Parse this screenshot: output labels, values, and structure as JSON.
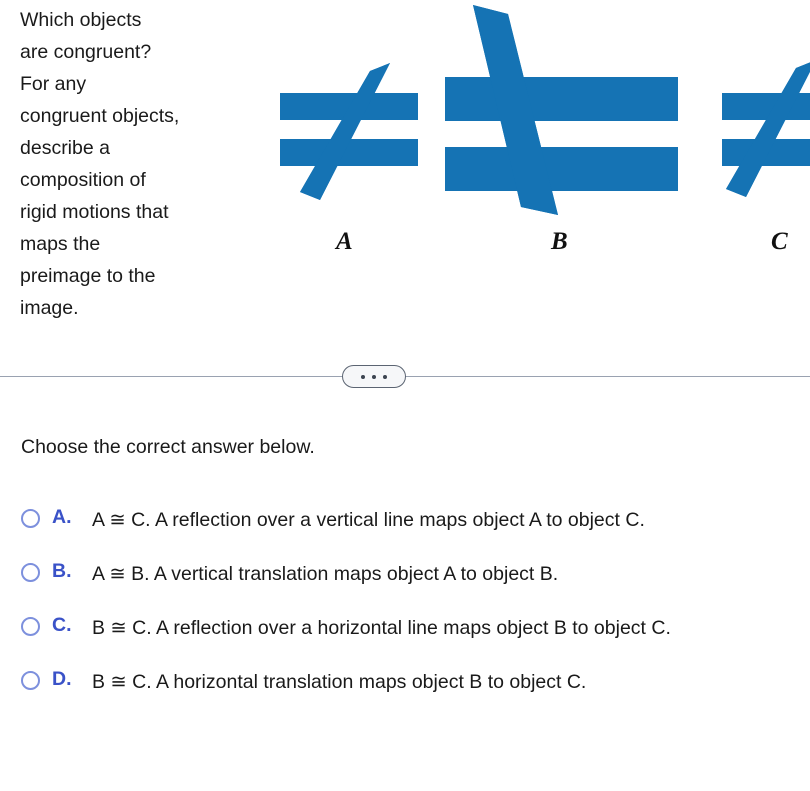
{
  "question": {
    "prompt": "Which objects\nare congruent?\nFor any\ncongruent objects,\ndescribe a\ncomposition of\nrigid motions that\nmaps the\npreimage to the\nimage."
  },
  "figure": {
    "shape_color": "#1573b4",
    "labels": {
      "a": "A",
      "b": "B",
      "c": "C"
    },
    "shapes": [
      {
        "id": "A",
        "symbol": "not-equal",
        "size": "small",
        "slash": "lower-left-to-upper-right"
      },
      {
        "id": "B",
        "symbol": "not-equal",
        "size": "large",
        "slash": "upper-left-to-lower-right"
      },
      {
        "id": "C",
        "symbol": "not-equal",
        "size": "small",
        "slash": "lower-left-to-upper-right",
        "clipped": "right-edge"
      }
    ]
  },
  "divider": {
    "expander_label": "...",
    "dots": 3
  },
  "answers": {
    "heading": "Choose the correct answer below.",
    "radio_border_color": "#7d90dd",
    "letter_color": "#3a52c8",
    "options": [
      {
        "letter": "A.",
        "text": "A ≅ C. A reflection over a vertical line maps object A to object C.",
        "selected": false
      },
      {
        "letter": "B.",
        "text": "A ≅ B. A vertical translation maps object A to object B.",
        "selected": false
      },
      {
        "letter": "C.",
        "text": "B ≅ C. A reflection over a horizontal line maps object B to object C.",
        "selected": false
      },
      {
        "letter": "D.",
        "text": "B ≅ C. A horizontal translation maps object B to object C.",
        "selected": false
      }
    ]
  }
}
